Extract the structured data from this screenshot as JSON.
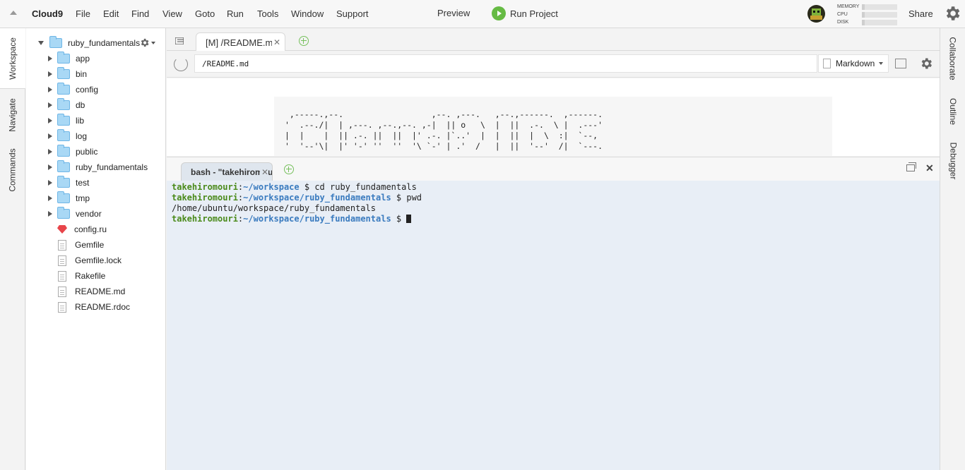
{
  "menubar": {
    "brand": "Cloud9",
    "menus": [
      "File",
      "Edit",
      "Find",
      "View",
      "Goto",
      "Run",
      "Tools",
      "Window",
      "Support"
    ],
    "preview": "Preview",
    "run_project": "Run Project",
    "metrics": [
      "MEMORY",
      "CPU",
      "DISK"
    ],
    "share": "Share"
  },
  "left_rail": {
    "tabs": [
      "Workspace",
      "Navigate",
      "Commands"
    ]
  },
  "tree": {
    "root": "ruby_fundamentals",
    "folders": [
      "app",
      "bin",
      "config",
      "db",
      "lib",
      "log",
      "public",
      "ruby_fundamentals",
      "test",
      "tmp",
      "vendor"
    ],
    "files": [
      {
        "name": "config.ru",
        "icon": "ruby-icon"
      },
      {
        "name": "Gemfile",
        "icon": "file-icon"
      },
      {
        "name": "Gemfile.lock",
        "icon": "file-icon"
      },
      {
        "name": "Rakefile",
        "icon": "file-icon"
      },
      {
        "name": "README.md",
        "icon": "file-icon"
      },
      {
        "name": "README.rdoc",
        "icon": "file-icon"
      }
    ]
  },
  "editor": {
    "tab_label": "[M] /README.md",
    "url": "/README.md",
    "mode": "Markdown",
    "ascii_art": " ,-----.,--.                  ,--. ,---.   ,--.,------.  ,------.\n'  .--./|  | ,---. ,--.,--. ,-|  || o   \\  |  ||  .-.  \\ |  .---'\n|  |    |  || .-. ||  ||  |' .-. |`..'  |  |  ||  |  \\  :|  `--,\n'  '--'\\|  |' '-' ''  ''  '\\ `-' | .'  /   |  ||  '--'  /|  `---."
  },
  "terminal": {
    "tab_label": "bash - \"takehiromouri@ruby\"",
    "lines": [
      {
        "user": "takehiromouri",
        "path": "~/workspace",
        "cmd": " $ cd ruby_fundamentals"
      },
      {
        "user": "takehiromouri",
        "path": "~/workspace/ruby_fundamentals",
        "cmd": " $ pwd"
      },
      {
        "output": "/home/ubuntu/workspace/ruby_fundamentals"
      },
      {
        "user": "takehiromouri",
        "path": "~/workspace/ruby_fundamentals",
        "cmd": " $ "
      }
    ]
  },
  "right_rail": {
    "tabs": [
      "Collaborate",
      "Outline",
      "Debugger"
    ]
  },
  "colors": {
    "run_green": "#66bb44",
    "folder_blue": "#a9d8f5",
    "terminal_bg": "#e8eef6",
    "prompt_user": "#4a8a1a",
    "prompt_path": "#3a7bbf"
  }
}
